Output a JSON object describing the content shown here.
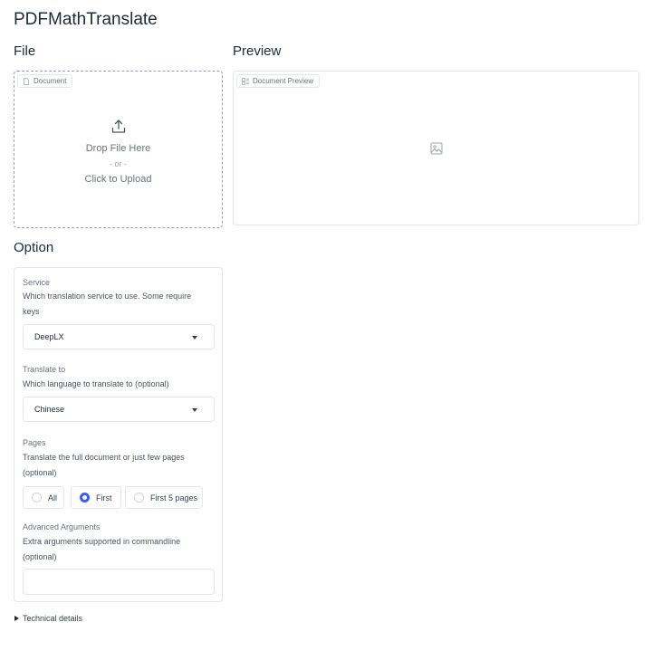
{
  "app": {
    "title": "PDFMathTranslate"
  },
  "file_section": {
    "title": "File",
    "tag_label": "Document",
    "drop_text": "Drop File Here",
    "or_text": "- or -",
    "click_text": "Click to Upload"
  },
  "preview_section": {
    "title": "Preview",
    "tag_label": "Document Preview"
  },
  "option_section": {
    "title": "Option",
    "service": {
      "label": "Service",
      "info": "Which translation service to use. Some require keys",
      "value": "DeepLX"
    },
    "translate_to": {
      "label": "Translate to",
      "info": "Which language to translate to (optional)",
      "value": "Chinese"
    },
    "pages": {
      "label": "Pages",
      "info": "Translate the full document or just few pages (optional)",
      "options": [
        "All",
        "First",
        "First 5 pages"
      ],
      "selected": "First"
    },
    "advanced": {
      "label": "Advanced Arguments",
      "info": "Extra arguments supported in commandline (optional)",
      "value": ""
    }
  },
  "technical_details": {
    "label": "Technical details"
  },
  "colors": {
    "accent": "#3b5bfd",
    "border": "#e5e7eb"
  }
}
